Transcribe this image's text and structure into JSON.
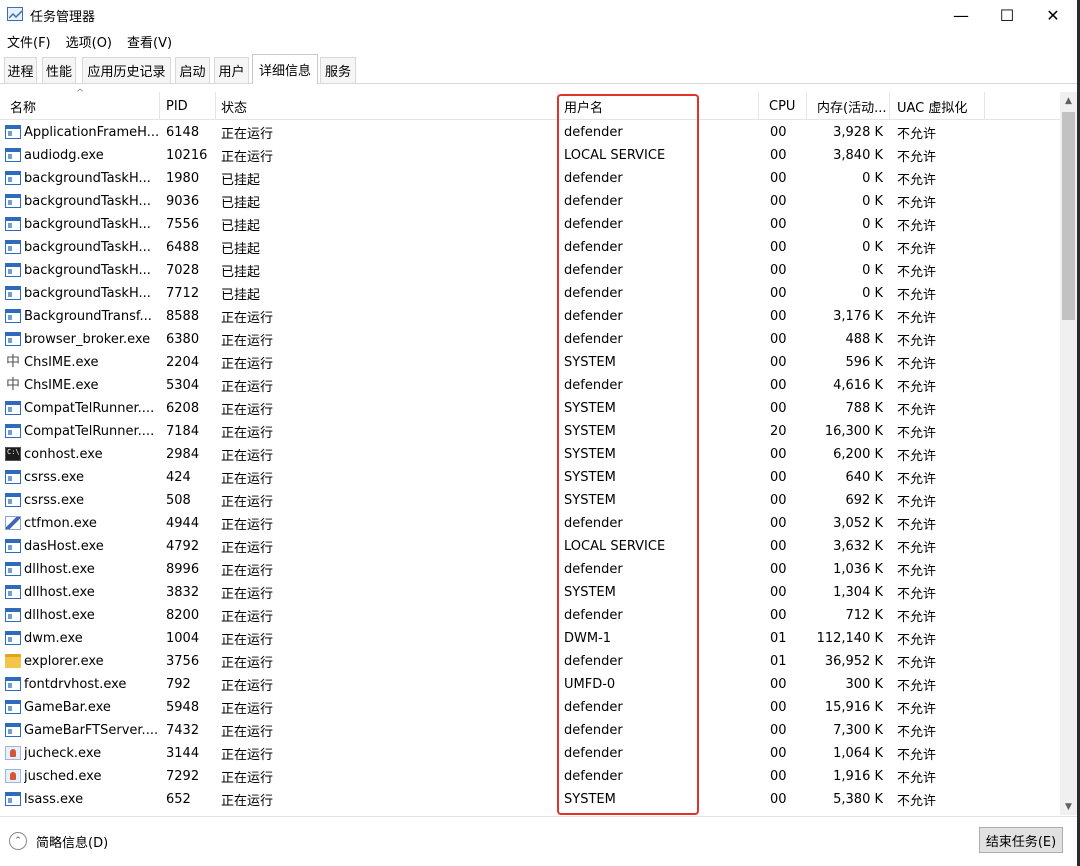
{
  "window": {
    "title": "任务管理器",
    "controls": {
      "minimize": "—",
      "maximize": "☐",
      "close": "✕"
    }
  },
  "menu": [
    "文件(F)",
    "选项(O)",
    "查看(V)"
  ],
  "tabs": [
    {
      "label": "进程",
      "active": false
    },
    {
      "label": "性能",
      "active": false
    },
    {
      "label": "应用历史记录",
      "active": false
    },
    {
      "label": "启动",
      "active": false
    },
    {
      "label": "用户",
      "active": false
    },
    {
      "label": "详细信息",
      "active": true
    },
    {
      "label": "服务",
      "active": false
    }
  ],
  "columns": {
    "name": "名称",
    "pid": "PID",
    "status": "状态",
    "user": "用户名",
    "cpu": "CPU",
    "memory": "内存(活动...",
    "uac": "UAC 虚拟化"
  },
  "sort_arrow": "^",
  "highlight_color": "#e0342b",
  "rows": [
    {
      "icon": "window-icon",
      "name": "ApplicationFrameH...",
      "pid": "6148",
      "status": "正在运行",
      "user": "defender",
      "cpu": "00",
      "memory": "3,928 K",
      "uac": "不允许"
    },
    {
      "icon": "window-icon",
      "name": "audiodg.exe",
      "pid": "10216",
      "status": "正在运行",
      "user": "LOCAL SERVICE",
      "cpu": "00",
      "memory": "3,840 K",
      "uac": "不允许"
    },
    {
      "icon": "window-icon",
      "name": "backgroundTaskH...",
      "pid": "1980",
      "status": "已挂起",
      "user": "defender",
      "cpu": "00",
      "memory": "0 K",
      "uac": "不允许"
    },
    {
      "icon": "window-icon",
      "name": "backgroundTaskH...",
      "pid": "9036",
      "status": "已挂起",
      "user": "defender",
      "cpu": "00",
      "memory": "0 K",
      "uac": "不允许"
    },
    {
      "icon": "window-icon",
      "name": "backgroundTaskH...",
      "pid": "7556",
      "status": "已挂起",
      "user": "defender",
      "cpu": "00",
      "memory": "0 K",
      "uac": "不允许"
    },
    {
      "icon": "window-icon",
      "name": "backgroundTaskH...",
      "pid": "6488",
      "status": "已挂起",
      "user": "defender",
      "cpu": "00",
      "memory": "0 K",
      "uac": "不允许"
    },
    {
      "icon": "window-icon",
      "name": "backgroundTaskH...",
      "pid": "7028",
      "status": "已挂起",
      "user": "defender",
      "cpu": "00",
      "memory": "0 K",
      "uac": "不允许"
    },
    {
      "icon": "window-icon",
      "name": "backgroundTaskH...",
      "pid": "7712",
      "status": "已挂起",
      "user": "defender",
      "cpu": "00",
      "memory": "0 K",
      "uac": "不允许"
    },
    {
      "icon": "window-icon",
      "name": "BackgroundTransf...",
      "pid": "8588",
      "status": "正在运行",
      "user": "defender",
      "cpu": "00",
      "memory": "3,176 K",
      "uac": "不允许"
    },
    {
      "icon": "window-icon",
      "name": "browser_broker.exe",
      "pid": "6380",
      "status": "正在运行",
      "user": "defender",
      "cpu": "00",
      "memory": "488 K",
      "uac": "不允许"
    },
    {
      "icon": "ime-icon",
      "name": "ChsIME.exe",
      "pid": "2204",
      "status": "正在运行",
      "user": "SYSTEM",
      "cpu": "00",
      "memory": "596 K",
      "uac": "不允许"
    },
    {
      "icon": "ime-icon",
      "name": "ChsIME.exe",
      "pid": "5304",
      "status": "正在运行",
      "user": "defender",
      "cpu": "00",
      "memory": "4,616 K",
      "uac": "不允许"
    },
    {
      "icon": "window-icon",
      "name": "CompatTelRunner....",
      "pid": "6208",
      "status": "正在运行",
      "user": "SYSTEM",
      "cpu": "00",
      "memory": "788 K",
      "uac": "不允许"
    },
    {
      "icon": "window-icon",
      "name": "CompatTelRunner....",
      "pid": "7184",
      "status": "正在运行",
      "user": "SYSTEM",
      "cpu": "20",
      "memory": "16,300 K",
      "uac": "不允许"
    },
    {
      "icon": "console-icon",
      "name": "conhost.exe",
      "pid": "2984",
      "status": "正在运行",
      "user": "SYSTEM",
      "cpu": "00",
      "memory": "6,200 K",
      "uac": "不允许"
    },
    {
      "icon": "window-icon",
      "name": "csrss.exe",
      "pid": "424",
      "status": "正在运行",
      "user": "SYSTEM",
      "cpu": "00",
      "memory": "640 K",
      "uac": "不允许"
    },
    {
      "icon": "window-icon",
      "name": "csrss.exe",
      "pid": "508",
      "status": "正在运行",
      "user": "SYSTEM",
      "cpu": "00",
      "memory": "692 K",
      "uac": "不允许"
    },
    {
      "icon": "pen-icon",
      "name": "ctfmon.exe",
      "pid": "4944",
      "status": "正在运行",
      "user": "defender",
      "cpu": "00",
      "memory": "3,052 K",
      "uac": "不允许"
    },
    {
      "icon": "window-icon",
      "name": "dasHost.exe",
      "pid": "4792",
      "status": "正在运行",
      "user": "LOCAL SERVICE",
      "cpu": "00",
      "memory": "3,632 K",
      "uac": "不允许"
    },
    {
      "icon": "window-icon",
      "name": "dllhost.exe",
      "pid": "8996",
      "status": "正在运行",
      "user": "defender",
      "cpu": "00",
      "memory": "1,036 K",
      "uac": "不允许"
    },
    {
      "icon": "window-icon",
      "name": "dllhost.exe",
      "pid": "3832",
      "status": "正在运行",
      "user": "SYSTEM",
      "cpu": "00",
      "memory": "1,304 K",
      "uac": "不允许"
    },
    {
      "icon": "window-icon",
      "name": "dllhost.exe",
      "pid": "8200",
      "status": "正在运行",
      "user": "defender",
      "cpu": "00",
      "memory": "712 K",
      "uac": "不允许"
    },
    {
      "icon": "window-icon",
      "name": "dwm.exe",
      "pid": "1004",
      "status": "正在运行",
      "user": "DWM-1",
      "cpu": "01",
      "memory": "112,140 K",
      "uac": "不允许"
    },
    {
      "icon": "folder-icon",
      "name": "explorer.exe",
      "pid": "3756",
      "status": "正在运行",
      "user": "defender",
      "cpu": "01",
      "memory": "36,952 K",
      "uac": "不允许"
    },
    {
      "icon": "window-icon",
      "name": "fontdrvhost.exe",
      "pid": "792",
      "status": "正在运行",
      "user": "UMFD-0",
      "cpu": "00",
      "memory": "300 K",
      "uac": "不允许"
    },
    {
      "icon": "window-icon",
      "name": "GameBar.exe",
      "pid": "5948",
      "status": "正在运行",
      "user": "defender",
      "cpu": "00",
      "memory": "15,916 K",
      "uac": "不允许"
    },
    {
      "icon": "window-icon",
      "name": "GameBarFTServer....",
      "pid": "7432",
      "status": "正在运行",
      "user": "defender",
      "cpu": "00",
      "memory": "7,300 K",
      "uac": "不允许"
    },
    {
      "icon": "java-icon",
      "name": "jucheck.exe",
      "pid": "3144",
      "status": "正在运行",
      "user": "defender",
      "cpu": "00",
      "memory": "1,064 K",
      "uac": "不允许"
    },
    {
      "icon": "java-icon",
      "name": "jusched.exe",
      "pid": "7292",
      "status": "正在运行",
      "user": "defender",
      "cpu": "00",
      "memory": "1,916 K",
      "uac": "不允许"
    },
    {
      "icon": "window-icon",
      "name": "lsass.exe",
      "pid": "652",
      "status": "正在运行",
      "user": "SYSTEM",
      "cpu": "00",
      "memory": "5,380 K",
      "uac": "不允许"
    }
  ],
  "scrollbar": {
    "up": "▲",
    "down": "▼"
  },
  "footer": {
    "chevron": "⌃",
    "brief_label": "简略信息(D)",
    "end_task_label": "结束任务(E)"
  }
}
